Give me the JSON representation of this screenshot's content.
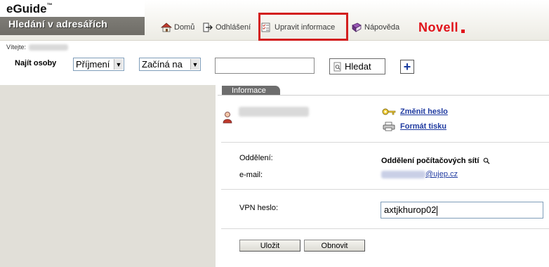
{
  "header": {
    "brand": "eGuide",
    "brand_tm": "™",
    "subtitle": "Hledání v adresářích",
    "nav": {
      "home": "Domů",
      "logout": "Odhlášení",
      "edit_info": "Upravit informace",
      "help": "Nápověda"
    },
    "logo": "Novell",
    "logo_color": "#e1121a",
    "highlight_color": "#d31f1f"
  },
  "welcome": {
    "label": "Vítejte:"
  },
  "search": {
    "label": "Najít osoby",
    "field_value": "Příjmení",
    "condition_value": "Začíná na",
    "query": "",
    "button": "Hledat",
    "add_icon": "plus-icon"
  },
  "detail": {
    "tab": "Informace",
    "links": {
      "change_password": "Změnit heslo",
      "print_format": "Formát tisku"
    },
    "fields": {
      "department_label": "Oddělení:",
      "department_value": "Oddělení počítačových sítí",
      "email_label": "e-mail:",
      "email_domain": "@ujep.cz",
      "vpn_label": "VPN heslo:",
      "vpn_value": "axtjkhurop02"
    },
    "buttons": {
      "save": "Uložit",
      "reset": "Obnovit"
    }
  },
  "colors": {
    "link": "#1f3aa0",
    "left_pane": "#e1dfd8",
    "tab": "#6d6d6d"
  }
}
